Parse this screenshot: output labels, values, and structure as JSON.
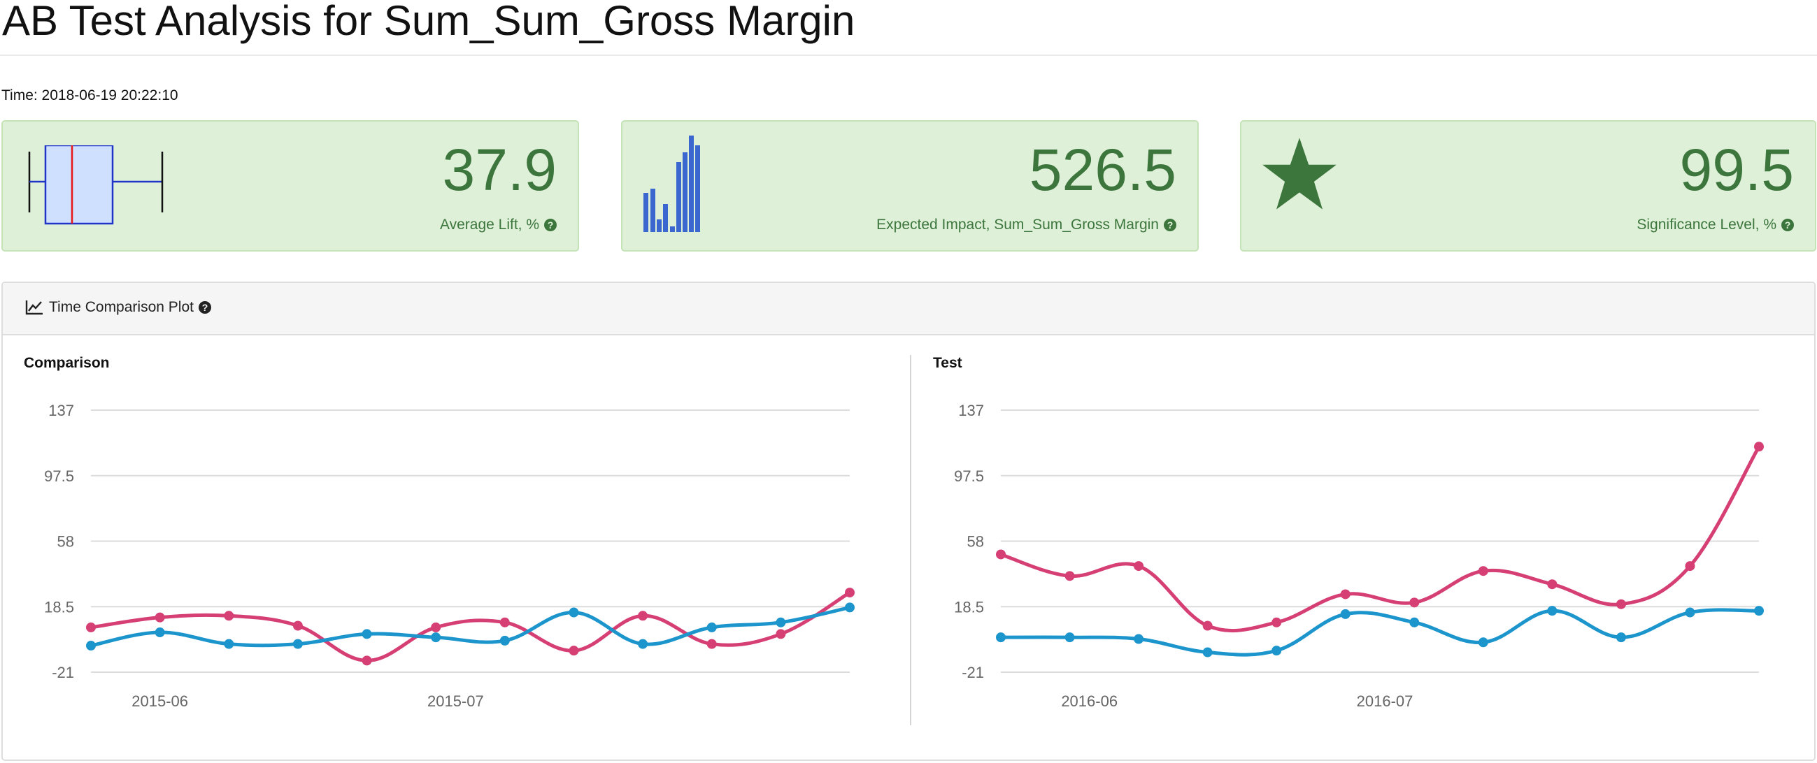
{
  "header": {
    "title": "AB Test Analysis for Sum_Sum_Gross Margin",
    "time": "Time: 2018-06-19 20:22:10"
  },
  "kpis": [
    {
      "value": "37.9",
      "label": "Average Lift, %",
      "icon": "boxplot-icon"
    },
    {
      "value": "526.5",
      "label": "Expected Impact, Sum_Sum_Gross Margin",
      "icon": "bar-chart-icon"
    },
    {
      "value": "99.5",
      "label": "Significance Level, %",
      "icon": "star-icon"
    }
  ],
  "panel": {
    "title": "Time Comparison Plot",
    "icon": "line-chart-icon"
  },
  "colors": {
    "series_a": "#d63f73",
    "series_b": "#1b95cc",
    "kpi_text": "#3c763d",
    "kpi_bg": "#dff0d8",
    "icon_bars": "#3a67d0"
  },
  "chart_data": [
    {
      "type": "line",
      "title": "Comparison",
      "yticks": [
        "137",
        "97.5",
        "58",
        "18.5",
        "-21"
      ],
      "ylim": [
        -21,
        137
      ],
      "x": [
        "2015-05-25",
        "2015-06-01",
        "2015-06-08",
        "2015-06-15",
        "2015-06-22",
        "2015-06-29",
        "2015-07-06",
        "2015-07-13",
        "2015-07-20",
        "2015-07-27",
        "2015-08-03",
        "2015-08-10"
      ],
      "xticks": [
        {
          "label": "2015-06",
          "date": "2015-06-01"
        },
        {
          "label": "2015-07",
          "date": "2015-07-01"
        }
      ],
      "series": [
        {
          "values": [
            6,
            12,
            13,
            7,
            -14,
            6,
            9,
            -8,
            13,
            -4,
            2,
            27
          ]
        },
        {
          "values": [
            -5,
            3,
            -4,
            -4,
            2,
            0,
            -2,
            15,
            -4,
            6,
            9,
            18
          ]
        }
      ]
    },
    {
      "type": "line",
      "title": "Test",
      "yticks": [
        "137",
        "97.5",
        "58",
        "18.5",
        "-21"
      ],
      "ylim": [
        -21,
        137
      ],
      "x": [
        "2016-05-23",
        "2016-05-30",
        "2016-06-06",
        "2016-06-13",
        "2016-06-20",
        "2016-06-27",
        "2016-07-04",
        "2016-07-11",
        "2016-07-18",
        "2016-07-25",
        "2016-08-01",
        "2016-08-08"
      ],
      "xticks": [
        {
          "label": "2016-06",
          "date": "2016-06-01"
        },
        {
          "label": "2016-07",
          "date": "2016-07-01"
        }
      ],
      "series": [
        {
          "values": [
            50,
            37,
            43,
            7,
            9,
            26,
            21,
            40,
            32,
            20,
            43,
            115
          ]
        },
        {
          "values": [
            0,
            0,
            -1,
            -9,
            -8,
            14,
            9,
            -3,
            16,
            0,
            15,
            16
          ]
        }
      ]
    }
  ]
}
